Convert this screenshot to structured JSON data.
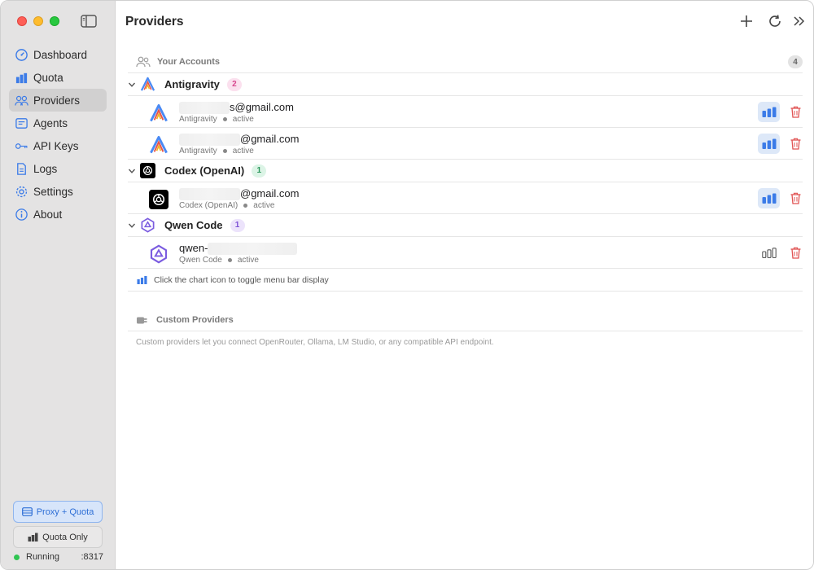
{
  "sidebar": {
    "items": [
      {
        "label": "Dashboard",
        "icon": "dashboard-icon"
      },
      {
        "label": "Quota",
        "icon": "quota-chart-icon"
      },
      {
        "label": "Providers",
        "icon": "providers-icon"
      },
      {
        "label": "Agents",
        "icon": "agents-icon"
      },
      {
        "label": "API Keys",
        "icon": "key-icon"
      },
      {
        "label": "Logs",
        "icon": "logs-icon"
      },
      {
        "label": "Settings",
        "icon": "gear-icon"
      },
      {
        "label": "About",
        "icon": "info-icon"
      }
    ],
    "active_index": 2,
    "modes": {
      "proxy_label": "Proxy + Quota",
      "quota_label": "Quota Only"
    },
    "status": {
      "label": "Running",
      "port": ":8317"
    }
  },
  "header": {
    "title": "Providers"
  },
  "accounts": {
    "section_label": "Your Accounts",
    "count": "4",
    "groups": [
      {
        "name": "Antigravity",
        "count": "2",
        "accounts": [
          {
            "email_suffix": "s@gmail.com",
            "provider": "Antigravity",
            "status": "active",
            "menu_bar": true
          },
          {
            "email_suffix": "@gmail.com",
            "provider": "Antigravity",
            "status": "active",
            "menu_bar": true
          }
        ]
      },
      {
        "name": "Codex (OpenAI)",
        "count": "1",
        "accounts": [
          {
            "email_suffix": "@gmail.com",
            "provider": "Codex (OpenAI)",
            "status": "active",
            "menu_bar": true
          }
        ]
      },
      {
        "name": "Qwen Code",
        "count": "1",
        "accounts": [
          {
            "email_suffix": "qwen-",
            "provider": "Qwen Code",
            "status": "active",
            "menu_bar": false
          }
        ]
      }
    ],
    "hint": "Click the chart icon to toggle menu bar display"
  },
  "custom": {
    "section_label": "Custom Providers",
    "description": "Custom providers let you connect OpenRouter, Ollama, LM Studio, or any compatible API endpoint."
  },
  "colors": {
    "accent": "#3b7be8",
    "danger": "#e05252",
    "running": "#30c552"
  }
}
